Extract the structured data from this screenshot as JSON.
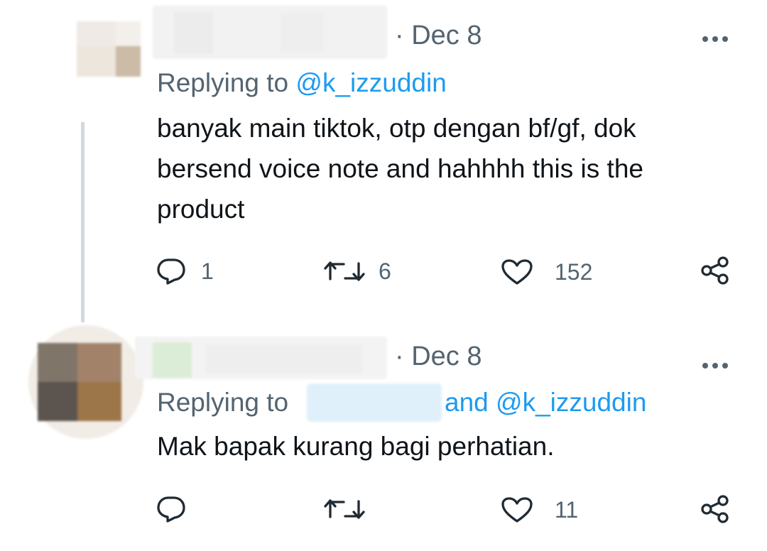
{
  "tweets": [
    {
      "date": "· Dec 8",
      "replying_prefix": "Replying to",
      "replying_handle": "@k_izzuddin",
      "body": "banyak main tiktok, otp dengan bf/gf, dok bersend voice note and hahhhh this is the product",
      "reply_count": "1",
      "retweet_count": "6",
      "like_count": "152"
    },
    {
      "date": "· Dec 8",
      "replying_prefix": "Replying to",
      "replying_and": "and",
      "replying_handle": "@k_izzuddin",
      "body": "Mak bapak kurang bagi perhatian.",
      "reply_count": "",
      "retweet_count": "",
      "like_count": "11"
    }
  ],
  "colors": {
    "text": "#0f1419",
    "muted": "#536471",
    "link": "#1d9bf0",
    "thread_line": "#cfd9de"
  },
  "icons": [
    "reply-icon",
    "retweet-icon",
    "like-icon",
    "share-icon",
    "more-icon"
  ]
}
